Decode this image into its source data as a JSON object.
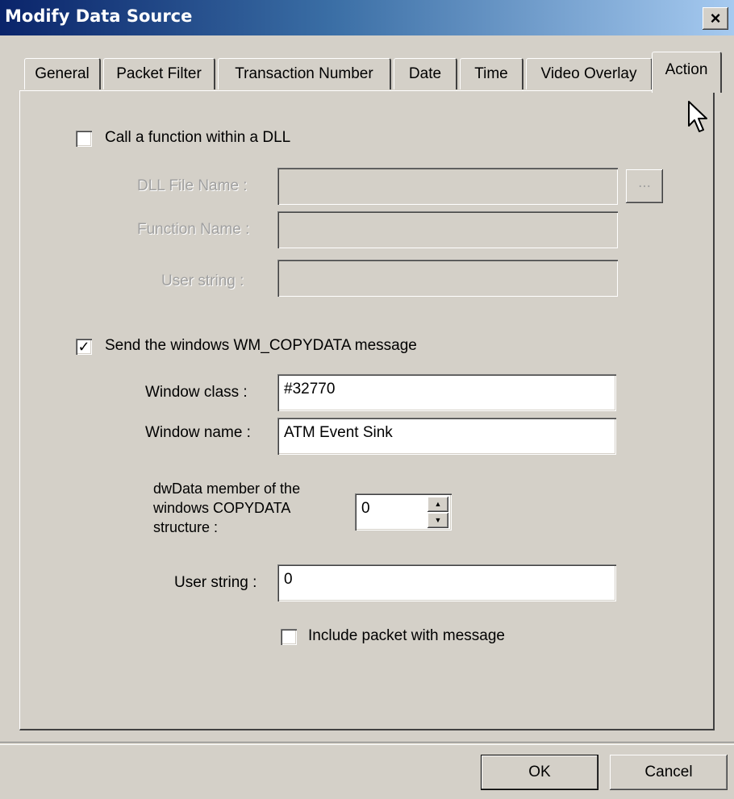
{
  "window": {
    "title": "Modify Data Source",
    "close_glyph": "×"
  },
  "tabs": [
    {
      "label": "General"
    },
    {
      "label": "Packet Filter"
    },
    {
      "label": "Transaction Number"
    },
    {
      "label": "Date"
    },
    {
      "label": "Time"
    },
    {
      "label": "Video Overlay"
    },
    {
      "label": "Action",
      "active": true
    }
  ],
  "dll_section": {
    "checkbox_label": "Call a function within a DLL",
    "checked": false,
    "dll_file_label": "DLL File Name :",
    "dll_file_value": "",
    "browse_label": "...",
    "function_label": "Function Name :",
    "function_value": "",
    "user_string_label": "User string :",
    "user_string_value": ""
  },
  "copydata_section": {
    "checkbox_label": "Send the windows WM_COPYDATA message",
    "checked": true,
    "check_glyph": "✓",
    "window_class_label": "Window class :",
    "window_class_value": "#32770",
    "window_name_label": "Window name :",
    "window_name_value": "ATM Event Sink",
    "dwdata_label_line1": "dwData member of the",
    "dwdata_label_line2": "windows COPYDATA",
    "dwdata_label_line3": "structure :",
    "dwdata_value": "0",
    "spin_up_glyph": "▲",
    "spin_down_glyph": "▼",
    "user_string_label": "User string :",
    "user_string_value": "0",
    "include_packet_label": "Include packet with message",
    "include_packet_checked": false
  },
  "buttons": {
    "ok_label": "OK",
    "cancel_label": "Cancel"
  }
}
